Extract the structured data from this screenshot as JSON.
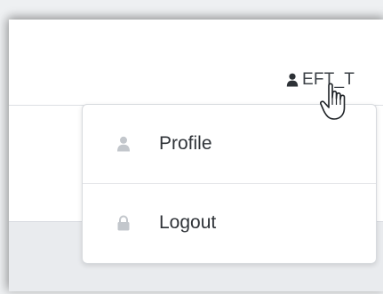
{
  "user_menu": {
    "username": "EFT_T",
    "user_icon": "user-icon",
    "items": [
      {
        "label": "Profile",
        "icon": "user-icon"
      },
      {
        "label": "Logout",
        "icon": "lock-icon"
      }
    ]
  },
  "colors": {
    "navbar_background": "#ffffff",
    "bottom_bar": "#e9ebee",
    "menu_icon": "#c3c7cc",
    "text": "#2f3338"
  }
}
